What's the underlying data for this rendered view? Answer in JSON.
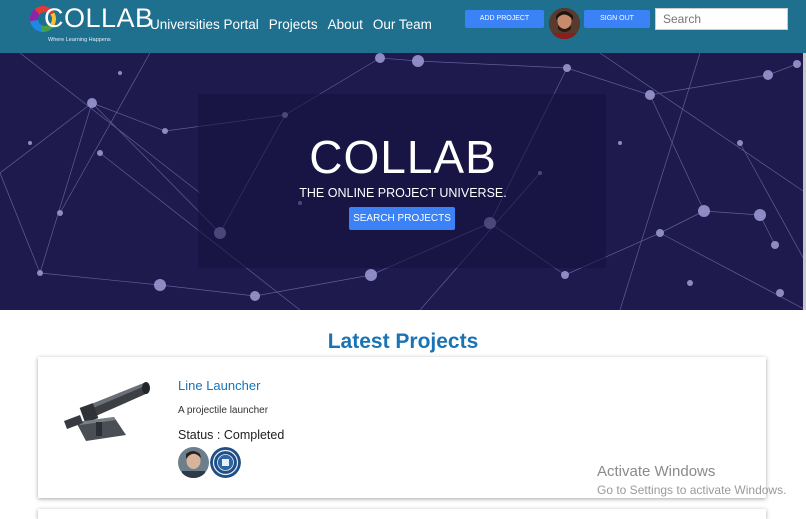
{
  "navbar": {
    "logo_text": "COLLAB",
    "logo_tagline": "Where Learning Happens",
    "links": [
      "Universities Portal",
      "Projects",
      "About",
      "Our Team"
    ],
    "add_project_label": "ADD PROJECT",
    "sign_out_label": "SIGN OUT",
    "search_placeholder": "Search"
  },
  "hero": {
    "title": "COLLAB",
    "subtitle": "THE ONLINE PROJECT UNIVERSE.",
    "button_label": "SEARCH PROJECTS"
  },
  "main": {
    "section_title": "Latest Projects",
    "projects": [
      {
        "title": "Line Launcher",
        "description": "A projectile launcher",
        "status": "Status : Completed"
      }
    ]
  },
  "watermark": {
    "line1": "Activate Windows",
    "line2": "Go to Settings to activate Windows."
  },
  "colors": {
    "navbar_bg": "#1f6f8f",
    "accent_button": "#3b82f6",
    "hero_bg": "#1e1a4d",
    "link_blue": "#1a73b5"
  },
  "icons": [
    "collab-logo-icon",
    "user-avatar-icon",
    "network-background",
    "project-thumbnail",
    "member-avatar-icon",
    "university-seal-icon"
  ]
}
